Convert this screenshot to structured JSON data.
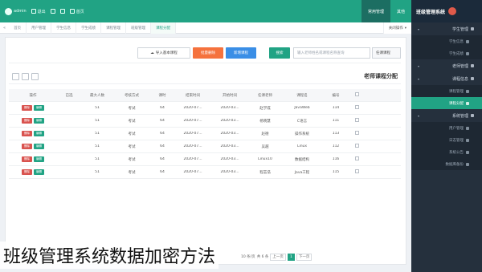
{
  "topbar": {
    "left_items": [
      "admin",
      "退出",
      "",
      "",
      ""
    ],
    "home_label": "首页",
    "btn_home": "常用管理",
    "btn_dark": "其他",
    "brand": "班级管理系统"
  },
  "tabs": {
    "items": [
      {
        "label": "首页"
      },
      {
        "label": "用户管理"
      },
      {
        "label": "学生信息"
      },
      {
        "label": "学生成绩"
      },
      {
        "label": "课程管理"
      },
      {
        "label": "班级管理"
      },
      {
        "label": "课程分配"
      }
    ],
    "active_index": 6,
    "right_label": "关闭操作"
  },
  "sidebar": {
    "groups": [
      {
        "label": "学生管理",
        "subs": [
          "学生信息",
          "学生成绩"
        ]
      },
      {
        "label": "老师管理",
        "subs": []
      },
      {
        "label": "课程信息",
        "subs": [
          "课程管理",
          "课程分配"
        ]
      },
      {
        "label": "系统管理",
        "subs": [
          "用户管理",
          "日志管理",
          "系统公告",
          "数据库备份"
        ]
      }
    ],
    "active_sub": "课程分配"
  },
  "search": {
    "label": "任课课程",
    "placeholder": "输入老师姓名或课程名称查询",
    "search_btn": "搜索",
    "add_btn": "新增课程",
    "batch_btn": "批量删除",
    "import_btn": "导入基本课程"
  },
  "table": {
    "title": "老师课程分配",
    "headers": [
      "",
      "编号",
      "课程名",
      "任课老师",
      "开始时间",
      "结束时间",
      "课时",
      "考核方式",
      "最大人数",
      "已选",
      "操作"
    ],
    "rows": [
      [
        "",
        "114",
        "JavaWeb",
        "赵学成",
        "2020-03...",
        "2020-07...",
        "64",
        "考试",
        "51",
        "",
        ""
      ],
      [
        "",
        "111",
        "C语言",
        "杨晓慧",
        "2020-03...",
        "2020-07...",
        "64",
        "考试",
        "51",
        "",
        ""
      ],
      [
        "",
        "113",
        "操作系统",
        "赵德",
        "2020-03...",
        "2020-07...",
        "64",
        "考试",
        "51",
        "",
        ""
      ],
      [
        "",
        "112",
        "Linux",
        "吴越",
        "2020-03...",
        "2020-07...",
        "64",
        "考试",
        "51",
        "",
        ""
      ],
      [
        "",
        "116",
        "数据结构",
        "Linux10",
        "2020-03...",
        "2020-07...",
        "64",
        "考试",
        "51",
        "",
        ""
      ],
      [
        "",
        "115",
        "Java工程",
        "程志浩",
        "2020-03...",
        "2020-07...",
        "64",
        "考试",
        "51",
        "",
        ""
      ]
    ],
    "op_edit": "编辑",
    "op_delete": "删除"
  },
  "pager": {
    "prev": "上一页",
    "pages": [
      "1"
    ],
    "next": "下一页",
    "info": "共 6 条",
    "size": "10 条/页"
  },
  "caption": "班级管理系统数据加密方法",
  "colors": {
    "accent": "#21a384",
    "sidebar": "#25303d",
    "orange": "#f5723d",
    "blue": "#3a8ee6",
    "red": "#d9534f"
  }
}
